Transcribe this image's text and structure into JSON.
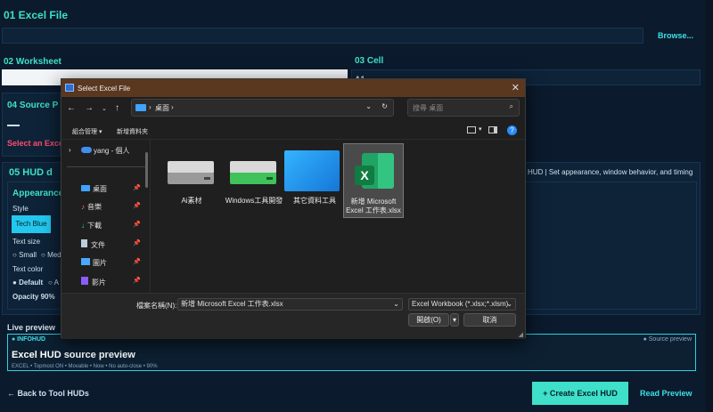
{
  "app": {
    "sections": {
      "excel_file": "01  Excel File",
      "worksheet": "02  Worksheet",
      "cell": "03  Cell",
      "source_partial": "04  Source P",
      "hud_partial": "05   HUD d"
    },
    "browse_label": "Browse...",
    "cell_value_partial": "A1",
    "select_excel_partial": "Select an Excel",
    "hud_hint_partial": "HUD | Set appearance, window behavior, and timing",
    "appearance_partial": "Appearance",
    "style_label": "Style",
    "style_btn": "Tech Blue",
    "text_size_label": "Text size",
    "size_small": "Small",
    "size_med_partial": "Med",
    "text_color_label": "Text color",
    "color_default": "Default",
    "color_a_partial": "A",
    "opacity": "Opacity  90%",
    "live_preview": "Live preview",
    "infohud": "● INFOHUD",
    "source_preview_tag": "● Source preview",
    "preview_title": "Excel HUD source preview",
    "preview_meta": "EXCEL  •  Topmost ON  •  Movable  •  Now  •  No auto-close  •  90%",
    "back_label": "← Back to Tool HUDs",
    "create_label": "+ Create Excel HUD",
    "read_label": "Read Preview"
  },
  "dialog": {
    "title": "Select Excel File",
    "address": "桌面",
    "search_placeholder": "搜尋 桌面",
    "organize": "組合管理 ▾",
    "new_folder": "新增資料夾",
    "tree_root": "yang - 個人",
    "nav_items": [
      "桌面",
      "音樂",
      "下載",
      "文件",
      "圖片",
      "影片"
    ],
    "files": [
      "Ai素材",
      "Windows工具開發",
      "其它資料工具",
      "新增 Microsoft Excel 工作表.xlsx"
    ],
    "filename_label": "檔案名稱(N):",
    "filename_value": "新增 Microsoft Excel 工作表.xlsx",
    "filter_value": "Excel Workbook (*.xlsx;*.xlsm)",
    "open_label": "開啟(O)",
    "cancel_label": "取消"
  },
  "colors": {
    "accent": "#3fe0c9",
    "link": "#3fe0e8",
    "warning": "#ff4d6a",
    "background": "#0b1a2c"
  }
}
